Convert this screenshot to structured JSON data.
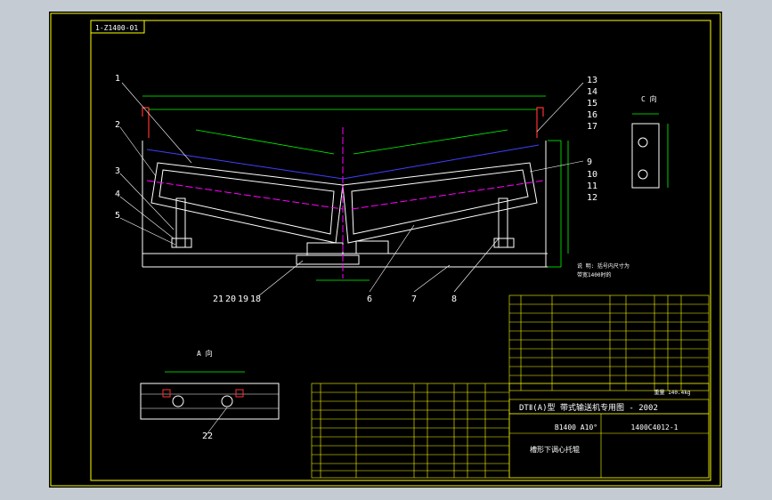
{
  "title_block_code": "1-Z1400-01",
  "colors": {
    "frame": "#ffff00",
    "parts": "#ffffff",
    "dims": "#00ff00",
    "center": "#ff00ff",
    "belt": "#4040ff",
    "table": "#ffff00",
    "highlight": "#ff3030"
  },
  "callouts": {
    "c1": "1",
    "c2": "2",
    "c3": "3",
    "c4": "4",
    "c5": "5",
    "c6": "6",
    "c7": "7",
    "c8": "8",
    "c9": "9",
    "c10": "10",
    "c11": "11",
    "c12": "12",
    "c13": "13",
    "c14": "14",
    "c15": "15",
    "c16": "16",
    "c17": "17",
    "c18": "18",
    "c19": "19",
    "c20": "20",
    "c21": "21",
    "c22": "22"
  },
  "view_labels": {
    "view_a": "A 向",
    "view_c": "C 向"
  },
  "notes": {
    "line1": "说 明: 括号内尺寸为",
    "line2": "带宽1400时的"
  },
  "title_block": {
    "standard": "DTⅡ(A)型  带式输送机专用图 - 2002",
    "spec": "B1400 A10°",
    "drawing_no": "1400C4012-1",
    "name": "槽形下调心托辊",
    "mass": "重量 140.4kg"
  }
}
